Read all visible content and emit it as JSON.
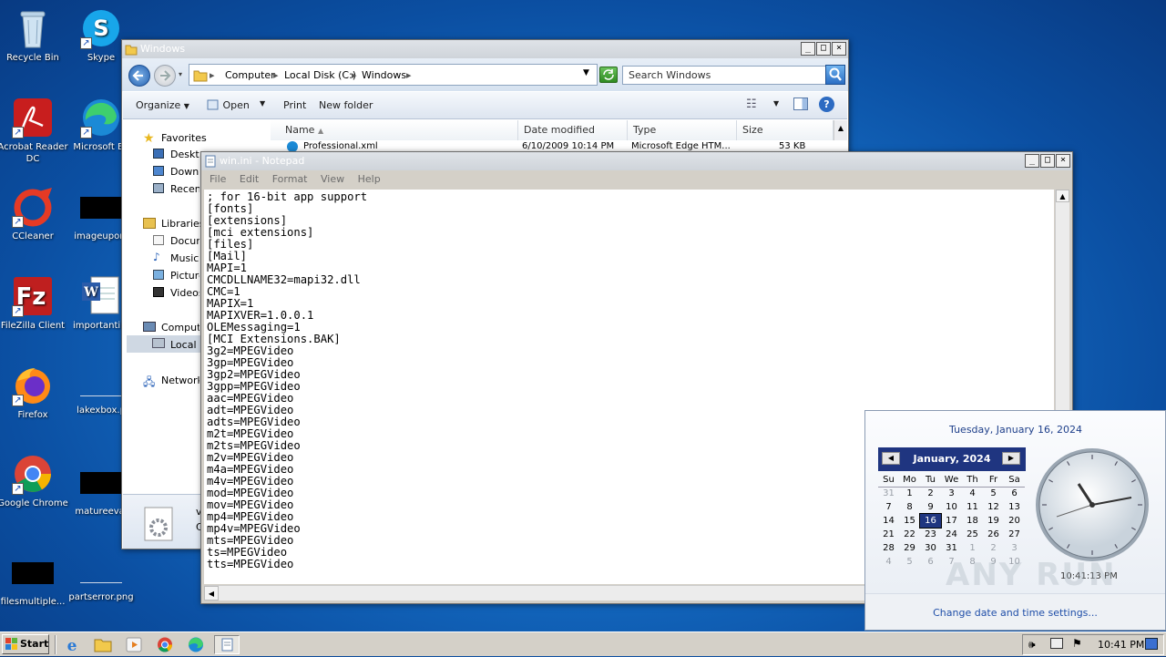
{
  "desktop": {
    "icons": [
      {
        "label": "Recycle Bin"
      },
      {
        "label": "Skype"
      },
      {
        "label": "Acrobat Reader DC"
      },
      {
        "label": "Microsoft Ed"
      },
      {
        "label": "CCleaner"
      },
      {
        "label": "imageupon."
      },
      {
        "label": "FileZilla Client"
      },
      {
        "label": "importantim"
      },
      {
        "label": "Firefox"
      },
      {
        "label": "lakexbox.p"
      },
      {
        "label": "Google Chrome"
      },
      {
        "label": "matureeval"
      },
      {
        "label": "filesmultiple..."
      },
      {
        "label": "partserror.png"
      }
    ]
  },
  "explorer": {
    "title": "Windows",
    "breadcrumb": [
      "Computer",
      "Local Disk (C:)",
      "Windows"
    ],
    "search_placeholder": "Search Windows",
    "toolbar": {
      "organize": "Organize",
      "open": "Open",
      "print": "Print",
      "new_folder": "New folder"
    },
    "nav": {
      "favorites": "Favorites",
      "desktop": "Desktop",
      "downloads": "Downloads",
      "recent": "Recent",
      "libraries": "Libraries",
      "documents": "Documents",
      "music": "Music",
      "pictures": "Pictures",
      "videos": "Videos",
      "computer": "Computer",
      "local_disk": "Local Disk",
      "network": "Network"
    },
    "columns": {
      "name": "Name",
      "date": "Date modified",
      "type": "Type",
      "size": "Size"
    },
    "rows": [
      {
        "name": "Professional.xml",
        "date": "6/10/2009 10:14 PM",
        "type": "Microsoft Edge HTM...",
        "size": "53 KB"
      }
    ],
    "details_text_1": "v",
    "details_text_2": "C"
  },
  "notepad": {
    "title": "win.ini - Notepad",
    "menu": {
      "file": "File",
      "edit": "Edit",
      "format": "Format",
      "view": "View",
      "help": "Help"
    },
    "lines": [
      "; for 16-bit app support",
      "[fonts]",
      "[extensions]",
      "[mci extensions]",
      "[files]",
      "[Mail]",
      "MAPI=1",
      "CMCDLLNAME32=mapi32.dll",
      "CMC=1",
      "MAPIX=1",
      "MAPIXVER=1.0.0.1",
      "OLEMessaging=1",
      "[MCI Extensions.BAK]",
      "3g2=MPEGVideo",
      "3gp=MPEGVideo",
      "3gp2=MPEGVideo",
      "3gpp=MPEGVideo",
      "aac=MPEGVideo",
      "adt=MPEGVideo",
      "adts=MPEGVideo",
      "m2t=MPEGVideo",
      "m2ts=MPEGVideo",
      "m2v=MPEGVideo",
      "m4a=MPEGVideo",
      "m4v=MPEGVideo",
      "mod=MPEGVideo",
      "mov=MPEGVideo",
      "mp4=MPEGVideo",
      "mp4v=MPEGVideo",
      "mts=MPEGVideo",
      "ts=MPEGVideo",
      "tts=MPEGVideo"
    ]
  },
  "clock_popup": {
    "date_long": "Tuesday, January 16, 2024",
    "month_label": "January, 2024",
    "weekdays": [
      "Su",
      "Mo",
      "Tu",
      "We",
      "Th",
      "Fr",
      "Sa"
    ],
    "weeks": [
      [
        "31",
        "1",
        "2",
        "3",
        "4",
        "5",
        "6"
      ],
      [
        "7",
        "8",
        "9",
        "10",
        "11",
        "12",
        "13"
      ],
      [
        "14",
        "15",
        "16",
        "17",
        "18",
        "19",
        "20"
      ],
      [
        "21",
        "22",
        "23",
        "24",
        "25",
        "26",
        "27"
      ],
      [
        "28",
        "29",
        "30",
        "31",
        "1",
        "2",
        "3"
      ],
      [
        "4",
        "5",
        "6",
        "7",
        "8",
        "9",
        "10"
      ]
    ],
    "selected_day": "16",
    "time": "10:41:13 PM",
    "change_link": "Change date and time settings...",
    "watermark": "ANY RUN"
  },
  "taskbar": {
    "start": "Start",
    "clock": "10:41 PM"
  },
  "colors": {
    "desktop": "#1670c8",
    "calendar_header": "#1f3580",
    "selected_day": "#1f3580",
    "link": "#0645ad"
  }
}
